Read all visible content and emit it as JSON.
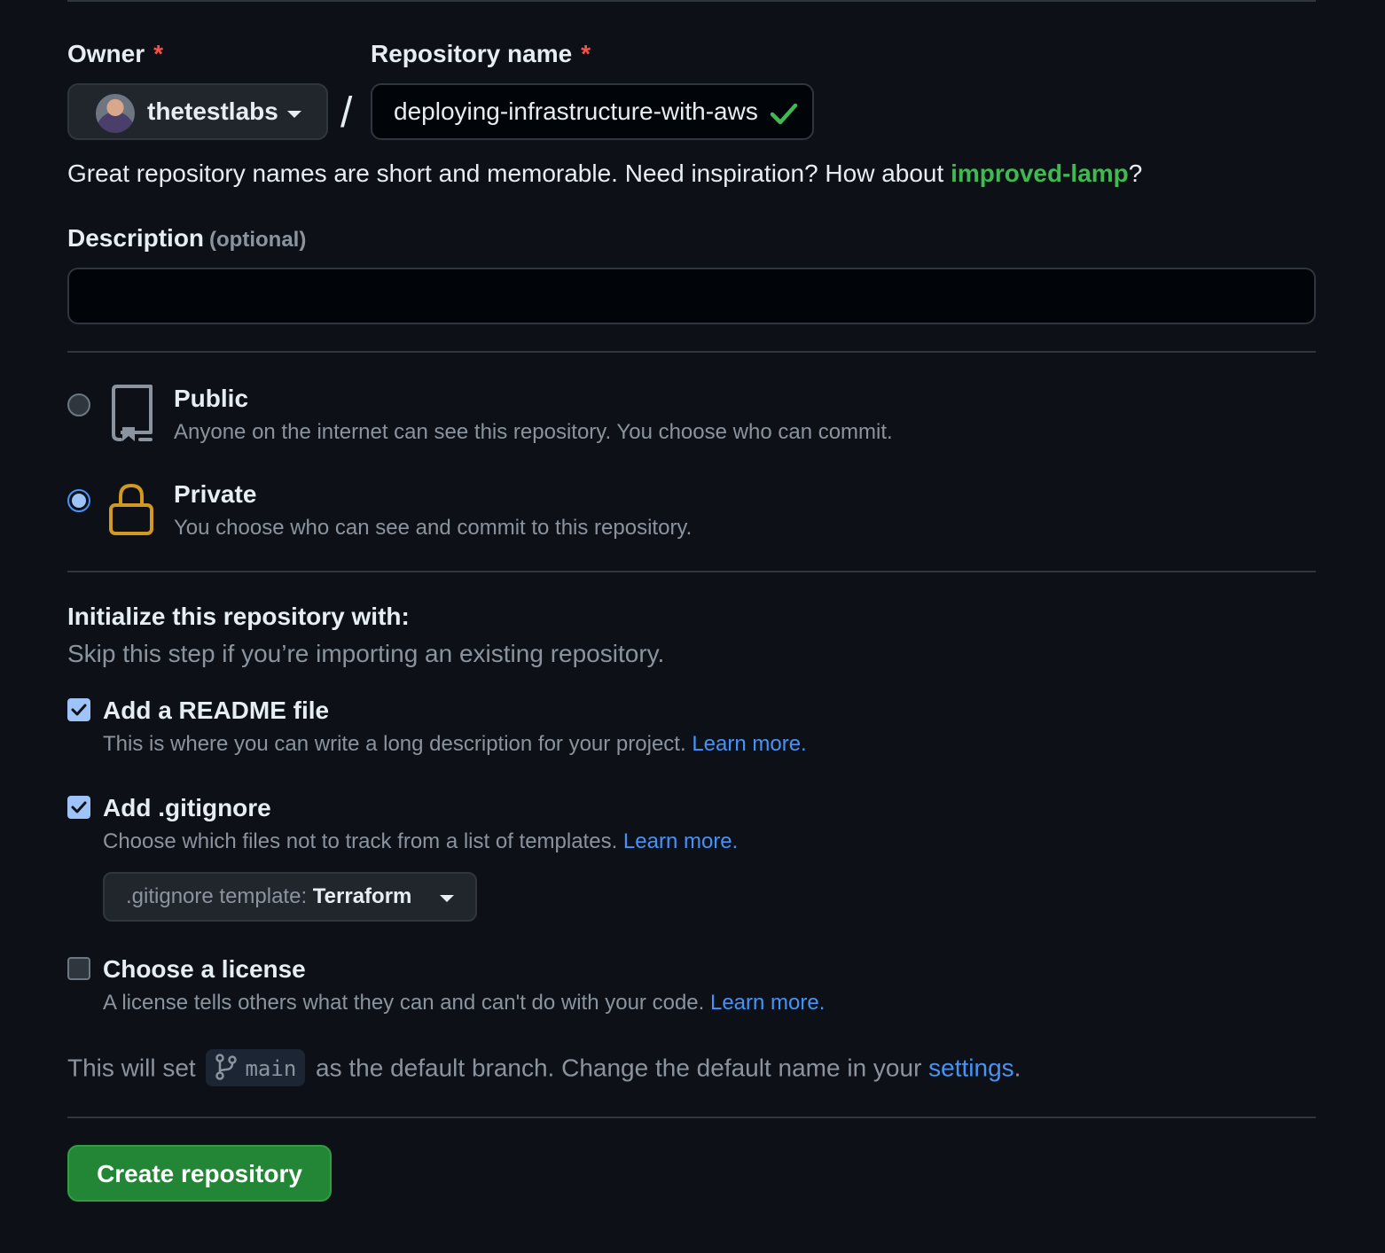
{
  "owner": {
    "label": "Owner",
    "required_mark": "*",
    "selected": "thetestlabs"
  },
  "repository_name": {
    "label": "Repository name",
    "required_mark": "*",
    "value": "deploying-infrastructure-with-aws"
  },
  "separator": "/",
  "name_hint": {
    "text": "Great repository names are short and memorable. Need inspiration? How about ",
    "suggestion": "improved-lamp",
    "suffix": "?"
  },
  "description": {
    "label": "Description",
    "optional": "(optional)",
    "value": ""
  },
  "visibility": {
    "selected": "private",
    "options": [
      {
        "title": "Public",
        "description": "Anyone on the internet can see this repository. You choose who can commit."
      },
      {
        "title": "Private",
        "description": "You choose who can see and commit to this repository."
      }
    ]
  },
  "initialize": {
    "title": "Initialize this repository with:",
    "subtitle": "Skip this step if you’re importing an existing repository.",
    "options": [
      {
        "title": "Add a README file",
        "description": "This is where you can write a long description for your project. ",
        "link": "Learn more.",
        "checked": true
      },
      {
        "title": "Add .gitignore",
        "description": "Choose which files not to track from a list of templates. ",
        "link": "Learn more.",
        "checked": true
      },
      {
        "title": "Choose a license",
        "description": "A license tells others what they can and can't do with your code. ",
        "link": "Learn more.",
        "checked": false
      }
    ],
    "gitignore_template": {
      "prefix": ".gitignore template: ",
      "value": "Terraform"
    }
  },
  "default_branch": {
    "before": "This will set ",
    "branch": "main",
    "after": " as the default branch. Change the default name in your ",
    "link": "settings",
    "end": "."
  },
  "submit": {
    "label": "Create repository"
  },
  "colors": {
    "background": "#0d1117",
    "success_green": "#3fb950",
    "link_blue": "#4493f8",
    "danger_red": "#f85149",
    "lock_yellow": "#d29922",
    "button_green": "#238636"
  },
  "icons": {
    "owner_caret": "triangle-down-icon",
    "name_valid": "check-icon",
    "public": "repo-icon",
    "private": "lock-icon",
    "branch": "git-branch-icon"
  }
}
